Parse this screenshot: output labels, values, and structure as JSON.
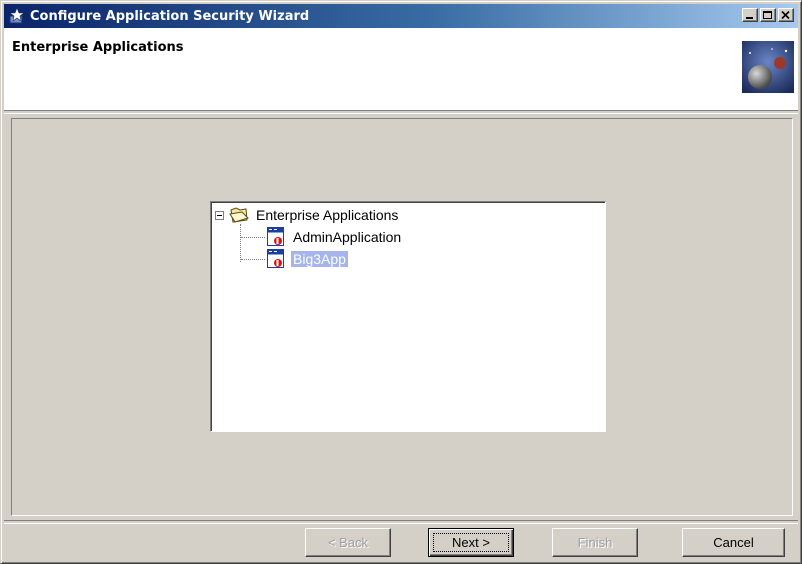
{
  "window": {
    "title": "Configure Application Security Wizard",
    "icon": "wizard-app-icon",
    "controls": [
      "minimize-icon",
      "maximize-icon",
      "close-icon"
    ]
  },
  "header": {
    "title": "Enterprise Applications",
    "graphic": "planet-banner-icon"
  },
  "tree": {
    "root": {
      "label": "Enterprise Applications",
      "icon": "folder-open-icon",
      "expanded": true
    },
    "children": [
      {
        "label": "AdminApplication",
        "icon": "enterprise-app-icon",
        "selected": false
      },
      {
        "label": "Big3App",
        "icon": "enterprise-app-icon",
        "selected": true
      }
    ]
  },
  "buttons": {
    "back": {
      "label": "< Back",
      "mnemonic": "B",
      "enabled": false
    },
    "next": {
      "label": "Next >",
      "mnemonic": "N",
      "enabled": true
    },
    "finish": {
      "label": "Finish",
      "mnemonic": "F",
      "enabled": false
    },
    "cancel": {
      "label": "Cancel",
      "enabled": true
    }
  },
  "colors": {
    "titlebar_start": "#0a246a",
    "titlebar_end": "#a6caf0",
    "dialog_bg": "#d4d0c8",
    "selection": "#a6b4ee"
  }
}
